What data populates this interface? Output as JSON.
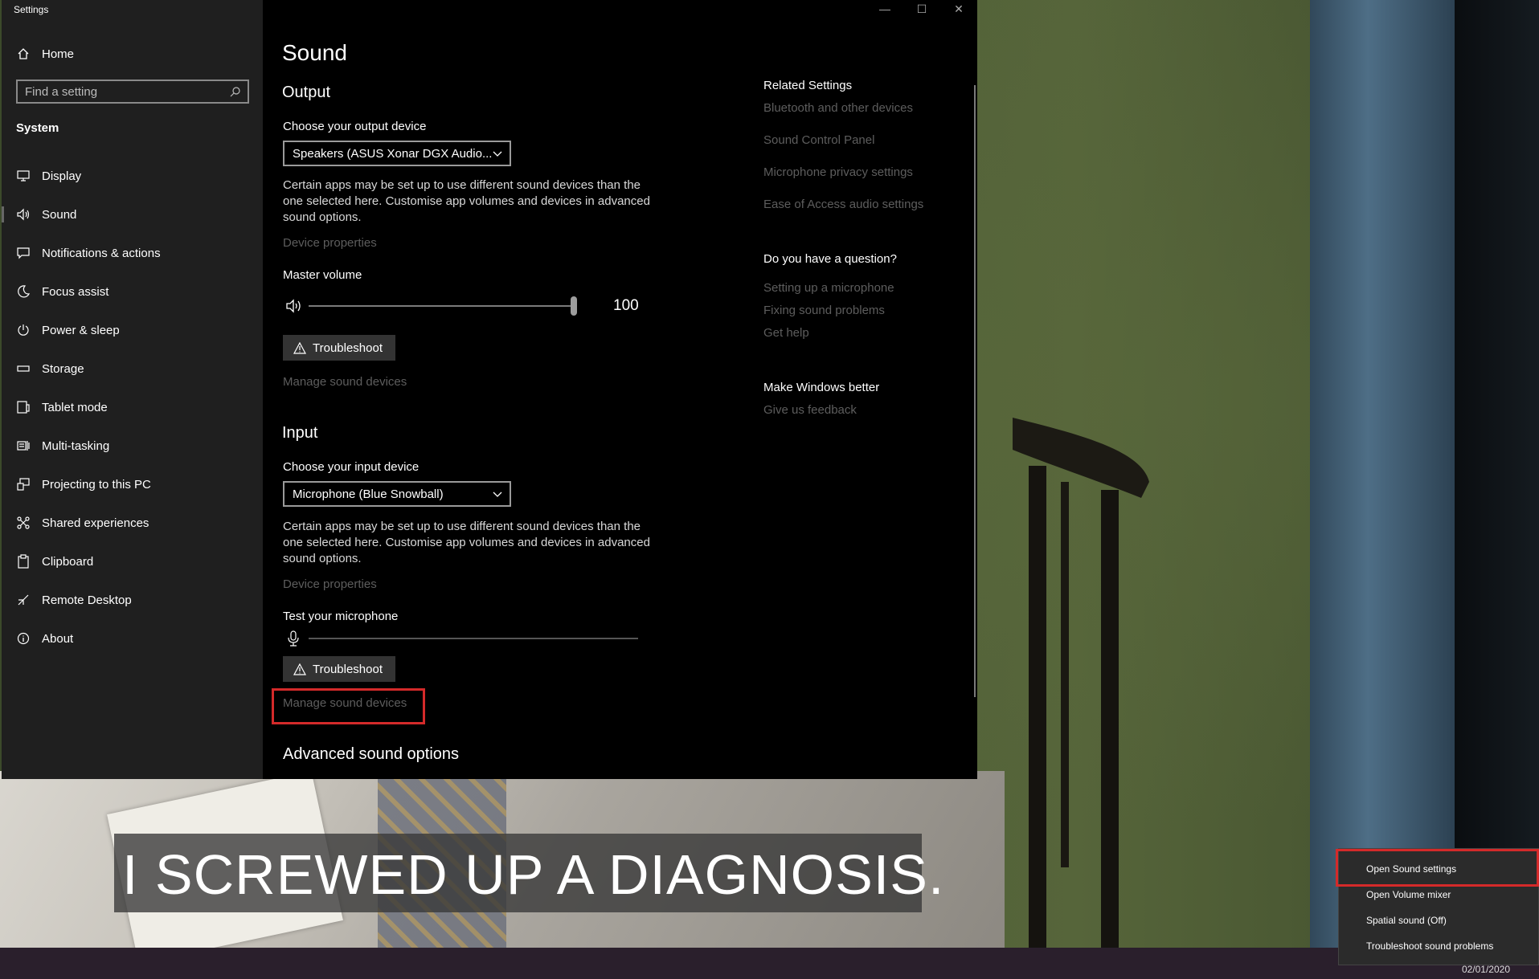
{
  "window": {
    "app_title": "Settings",
    "controls": {
      "minimize": "—",
      "maximize": "☐",
      "close": "✕"
    }
  },
  "sidebar": {
    "home_label": "Home",
    "search_placeholder": "Find a setting",
    "section_label": "System",
    "items": [
      {
        "label": "Display",
        "icon": "monitor-icon"
      },
      {
        "label": "Sound",
        "icon": "speaker-icon",
        "active": true
      },
      {
        "label": "Notifications & actions",
        "icon": "notification-icon"
      },
      {
        "label": "Focus assist",
        "icon": "moon-icon"
      },
      {
        "label": "Power & sleep",
        "icon": "power-icon"
      },
      {
        "label": "Storage",
        "icon": "storage-icon"
      },
      {
        "label": "Tablet mode",
        "icon": "tablet-icon"
      },
      {
        "label": "Multi-tasking",
        "icon": "multitask-icon"
      },
      {
        "label": "Projecting to this PC",
        "icon": "projector-icon"
      },
      {
        "label": "Shared experiences",
        "icon": "share-icon"
      },
      {
        "label": "Clipboard",
        "icon": "clipboard-icon"
      },
      {
        "label": "Remote Desktop",
        "icon": "remote-desktop-icon"
      },
      {
        "label": "About",
        "icon": "info-icon"
      }
    ]
  },
  "main": {
    "page_title": "Sound",
    "output": {
      "heading": "Output",
      "choose_label": "Choose your output device",
      "device_value": "Speakers (ASUS Xonar DGX Audio...",
      "description": "Certain apps may be set up to use different sound devices than the one selected here. Customise app volumes and devices in advanced sound options.",
      "device_properties": "Device properties",
      "master_volume_label": "Master volume",
      "volume_value": "100",
      "volume_level": 100,
      "troubleshoot": "Troubleshoot",
      "manage_devices": "Manage sound devices"
    },
    "input": {
      "heading": "Input",
      "choose_label": "Choose your input device",
      "device_value": "Microphone (Blue Snowball)",
      "description": "Certain apps may be set up to use different sound devices than the one selected here. Customise app volumes and devices in advanced sound options.",
      "device_properties": "Device properties",
      "test_label": "Test your microphone",
      "mic_level": 0,
      "troubleshoot": "Troubleshoot",
      "manage_devices": "Manage sound devices"
    },
    "advanced_heading": "Advanced sound options"
  },
  "related": {
    "heading": "Related Settings",
    "links": [
      "Bluetooth and other devices",
      "Sound Control Panel",
      "Microphone privacy settings",
      "Ease of Access audio settings"
    ],
    "question_heading": "Do you have a question?",
    "question_links": [
      "Setting up a microphone",
      "Fixing sound problems",
      "Get help"
    ],
    "better_heading": "Make Windows better",
    "feedback_link": "Give us feedback"
  },
  "subtitle": "I SCREWED UP A DIAGNOSIS.",
  "context_menu": {
    "items": [
      "Open Sound settings",
      "Open Volume mixer",
      "Spatial sound (Off)",
      "Troubleshoot sound problems"
    ]
  },
  "taskbar": {
    "date": "02/01/2020"
  },
  "colors": {
    "highlight_red": "#d42a2a",
    "window_bg": "#000000",
    "sidebar_bg": "#1f1f1f",
    "dim_link": "#5d5d5d"
  }
}
